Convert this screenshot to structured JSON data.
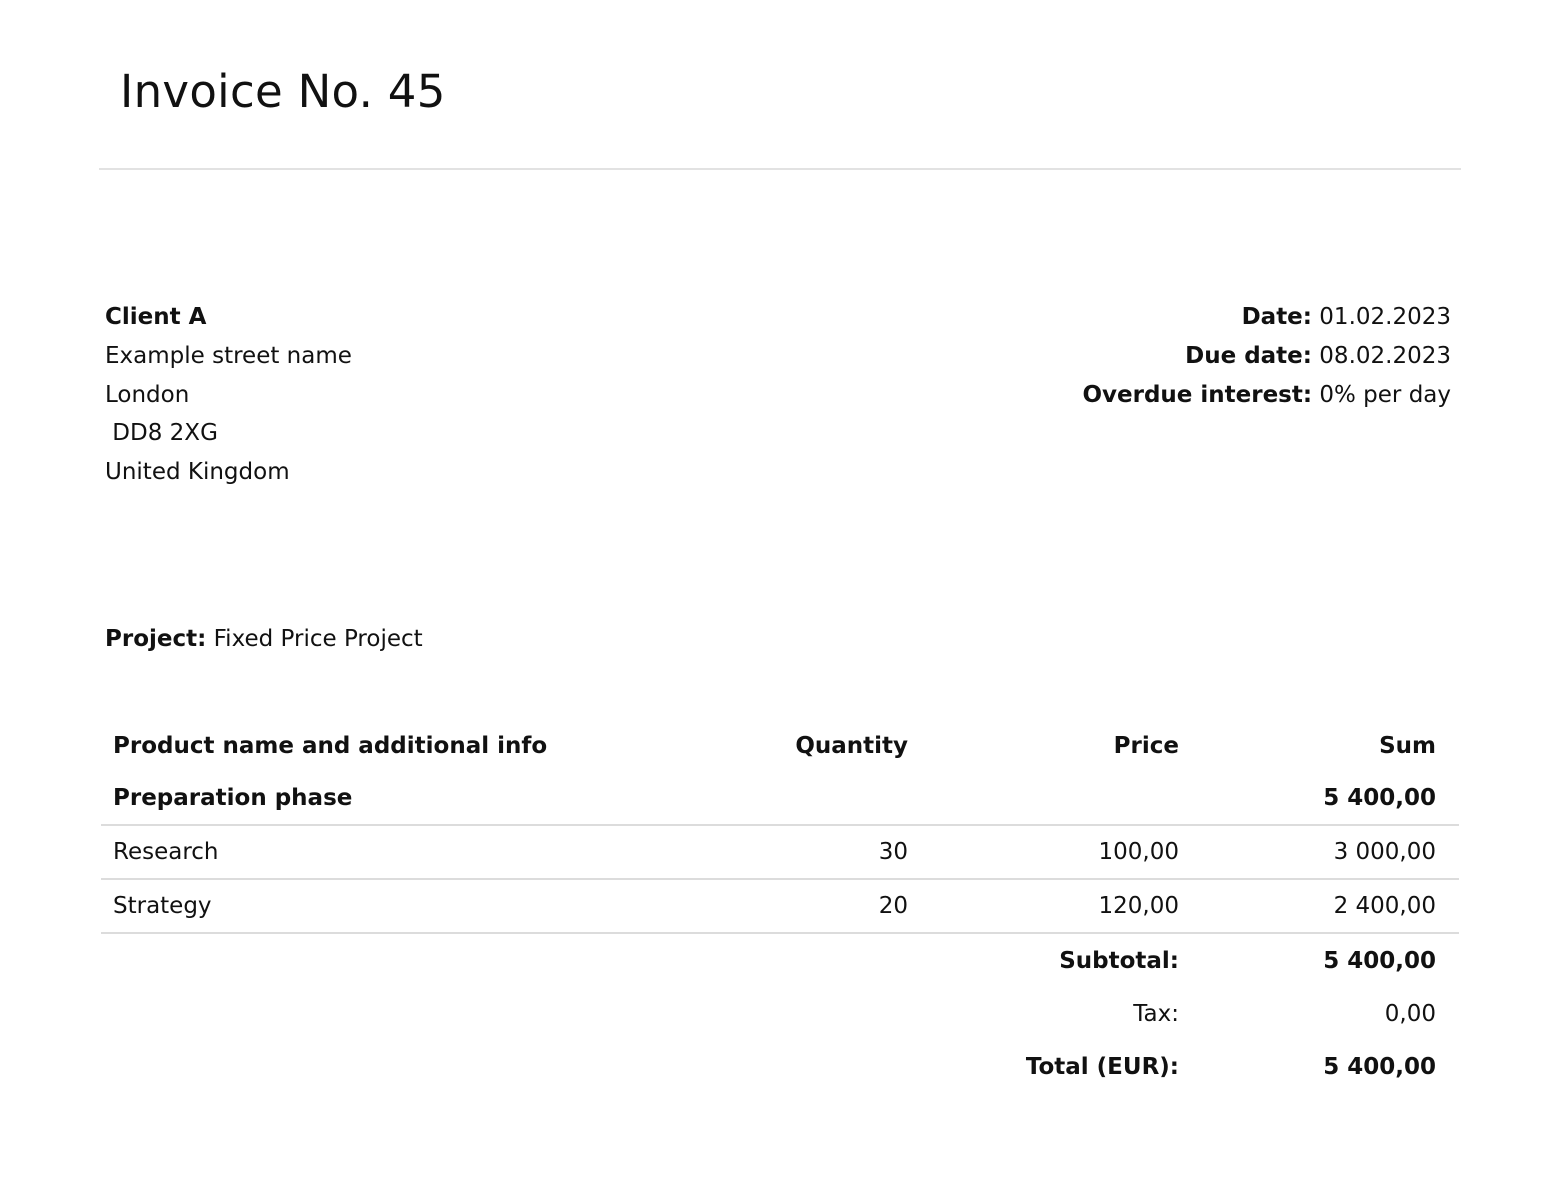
{
  "invoice": {
    "title": "Invoice No. 45"
  },
  "client": {
    "name": "Client A",
    "street": "Example street name",
    "city": "London",
    "postcode": " DD8 2XG",
    "country": "United Kingdom"
  },
  "meta": {
    "date_label": "Date:",
    "date_value": "01.02.2023",
    "due_label": "Due date:",
    "due_value": "08.02.2023",
    "interest_label": "Overdue interest:",
    "interest_value": "0% per day"
  },
  "project": {
    "label": "Project:",
    "value": "Fixed Price Project"
  },
  "table": {
    "headers": {
      "name": "Product name and additional info",
      "quantity": "Quantity",
      "price": "Price",
      "sum": "Sum"
    },
    "group": {
      "name": "Preparation phase",
      "sum": "5 400,00"
    },
    "rows": [
      {
        "name": "Research",
        "quantity": "30",
        "price": "100,00",
        "sum": "3 000,00"
      },
      {
        "name": "Strategy",
        "quantity": "20",
        "price": "120,00",
        "sum": "2 400,00"
      }
    ],
    "totals": {
      "subtotal_label": "Subtotal:",
      "subtotal_value": "5 400,00",
      "tax_label": "Tax:",
      "tax_value": "0,00",
      "total_label": "Total (EUR):",
      "total_value": "5 400,00"
    }
  }
}
